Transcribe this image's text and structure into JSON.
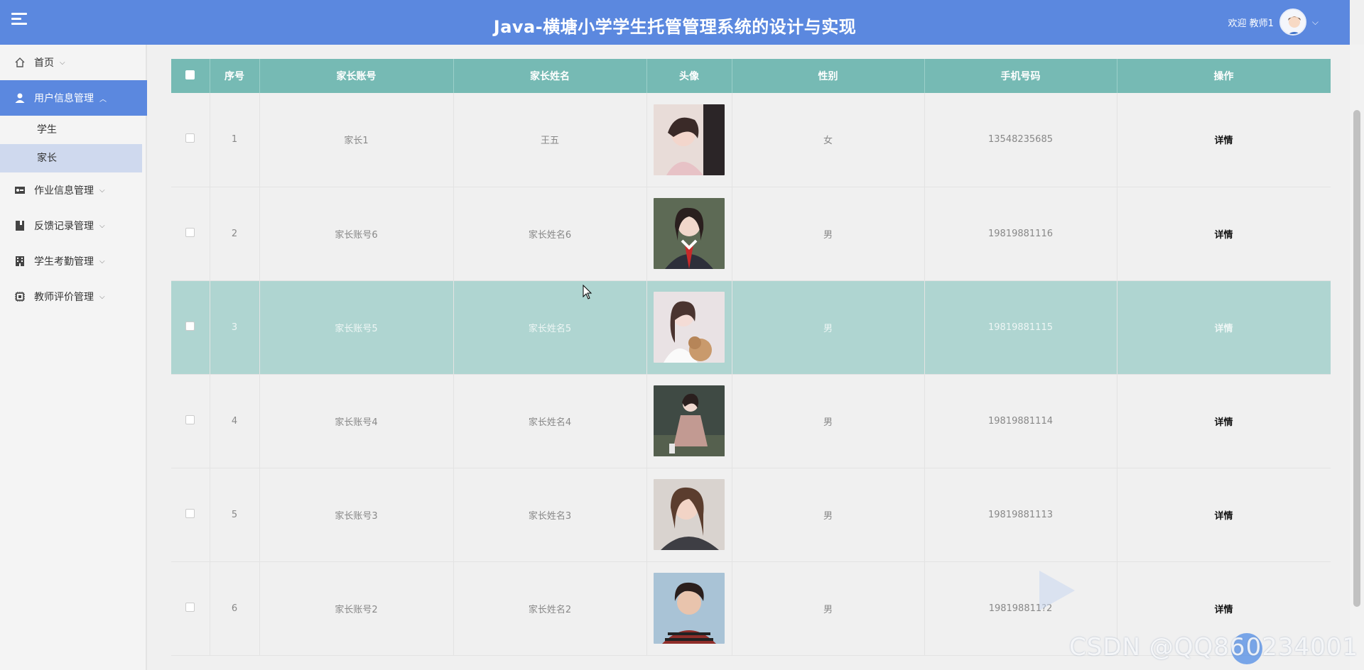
{
  "header": {
    "title": "Java-横塘小学学生托管管理系统的设计与实现",
    "welcome": "欢迎 教师1"
  },
  "sidebar": {
    "items": [
      {
        "label": "首页",
        "icon": "home-icon"
      },
      {
        "label": "用户信息管理",
        "icon": "user-icon",
        "expanded": true,
        "children": [
          {
            "label": "学生"
          },
          {
            "label": "家长",
            "active": true
          }
        ]
      },
      {
        "label": "作业信息管理",
        "icon": "id-card-icon"
      },
      {
        "label": "反馈记录管理",
        "icon": "book-icon"
      },
      {
        "label": "学生考勤管理",
        "icon": "building-icon"
      },
      {
        "label": "教师评价管理",
        "icon": "chip-icon"
      }
    ]
  },
  "table": {
    "columns": [
      "序号",
      "家长账号",
      "家长姓名",
      "头像",
      "性别",
      "手机号码",
      "操作"
    ],
    "rows": [
      {
        "index": "1",
        "account": "家长1",
        "name": "王五",
        "gender": "女",
        "phone": "13548235685",
        "action": "详情"
      },
      {
        "index": "2",
        "account": "家长账号6",
        "name": "家长姓名6",
        "gender": "男",
        "phone": "19819881116",
        "action": "详情"
      },
      {
        "index": "3",
        "account": "家长账号5",
        "name": "家长姓名5",
        "gender": "男",
        "phone": "19819881115",
        "action": "详情",
        "highlighted": true
      },
      {
        "index": "4",
        "account": "家长账号4",
        "name": "家长姓名4",
        "gender": "男",
        "phone": "19819881114",
        "action": "详情"
      },
      {
        "index": "5",
        "account": "家长账号3",
        "name": "家长姓名3",
        "gender": "男",
        "phone": "19819881113",
        "action": "详情"
      },
      {
        "index": "6",
        "account": "家长账号2",
        "name": "家长姓名2",
        "gender": "男",
        "phone": "198198811?2",
        "action": "详情"
      }
    ]
  },
  "watermark": "CSDN @QQ860234001",
  "colors": {
    "header": "#5b88df",
    "table_head": "#76bab4",
    "row_highlight": "#afd5d1"
  }
}
